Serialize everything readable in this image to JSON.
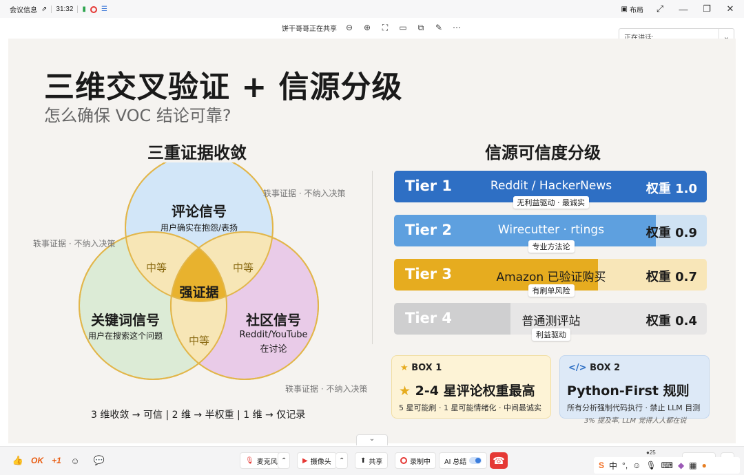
{
  "titlebar": {
    "meeting_info": "会议信息",
    "timer": "31:32",
    "layout_label": "布局"
  },
  "share_toolbar": {
    "sharing_text": "饼干哥哥正在共享"
  },
  "speaking": {
    "label": "正在讲话:"
  },
  "slide": {
    "title": "三维交叉验证 + 信源分级",
    "subtitle": "怎么确保 VOC 结论可靠?",
    "left_heading": "三重证据收敛",
    "right_heading": "信源可信度分级",
    "venn": {
      "circle_review": {
        "title": "评论信号",
        "desc": "用户确实在抱怨/表扬",
        "color": "#d2e6f8"
      },
      "circle_keyword": {
        "title": "关键词信号",
        "desc": "用户在搜索这个问题",
        "color": "#dcebd6"
      },
      "circle_community": {
        "title": "社区信号",
        "desc_line1": "Reddit/YouTube",
        "desc_line2": "在讨论",
        "color": "#e9cbe8"
      },
      "overlap_medium": "中等",
      "center": "强证据",
      "anecdote": "轶事证据 · 不纳入决策",
      "legend": "3 维收敛 → 可信 | 2 维 → 半权重 | 1 维 → 仅记录"
    },
    "tiers": [
      {
        "name": "Tier 1",
        "source": "Reddit / HackerNews",
        "weight_label": "权重 1.0",
        "weight": 1.0,
        "tag": "无利益驱动 · 最诚实",
        "fill": "#2e6fc4",
        "track": "#2e6fc4",
        "name_color": "#ffffff",
        "src_color": "#ffffff"
      },
      {
        "name": "Tier 2",
        "source": "Wirecutter · rtings",
        "weight_label": "权重 0.9",
        "weight": 0.9,
        "tag": "专业方法论",
        "fill": "#5ea0df",
        "track": "#cfe2f3",
        "name_color": "#ffffff",
        "src_color": "#ffffff"
      },
      {
        "name": "Tier 3",
        "source": "Amazon 已验证购买",
        "weight_label": "权重 0.7",
        "weight": 0.7,
        "tag": "有刷单风险",
        "fill": "#e6ac1f",
        "track": "#f8e6b8",
        "name_color": "#ffffff",
        "src_color": "#1a1a1a"
      },
      {
        "name": "Tier 4",
        "source": "普通测评站",
        "weight_label": "权重 0.4",
        "weight": 0.4,
        "tag": "利益驱动",
        "fill": "#cfcfd0",
        "track": "#e7e6e6",
        "name_color": "#ffffff",
        "src_color": "#1a1a1a"
      }
    ],
    "box1": {
      "head": "BOX 1",
      "title": "2-4 星评论权重最高",
      "desc": "5 星可能刷 · 1 星可能情绪化 · 中间最诚实"
    },
    "box2": {
      "head": "BOX 2",
      "title": "Python-First 规则",
      "desc": "所有分析强制代码执行 · 禁止 LLM 目测",
      "note": "3% 提及率, LLM 觉得人人都在说"
    }
  },
  "bottombar": {
    "plus_one": "+1",
    "mic": "麦克风",
    "camera": "摄像头",
    "share": "共享",
    "recording": "录制中",
    "ai_summary": "AI 总结",
    "participants_count": "25",
    "caption": "字幕"
  },
  "ime": {
    "mode": "中"
  }
}
